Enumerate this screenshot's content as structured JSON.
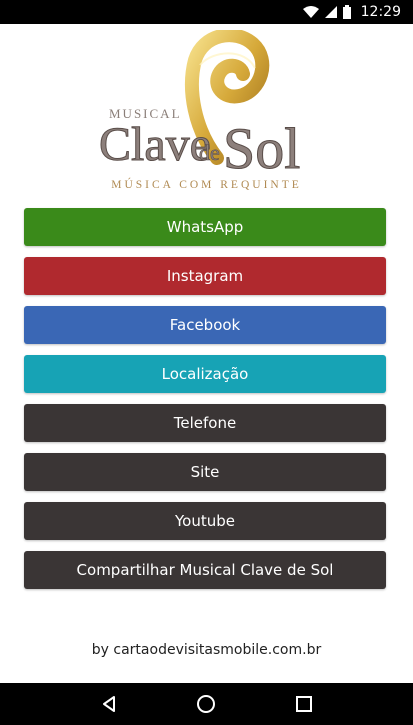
{
  "status_bar": {
    "time": "12:29",
    "icons": [
      "wifi-icon",
      "signal-icon",
      "battery-icon"
    ]
  },
  "logo": {
    "line1": "MUSICAL",
    "line2": "Clave",
    "line3": "de",
    "line4": "Sol",
    "tagline": "MÚSICA COM REQUINTE"
  },
  "buttons": [
    {
      "label": "WhatsApp",
      "color": "#3a8a1a"
    },
    {
      "label": "Instagram",
      "color": "#b0292e"
    },
    {
      "label": "Facebook",
      "color": "#3a67b5"
    },
    {
      "label": "Localização",
      "color": "#17a3b5"
    },
    {
      "label": "Telefone",
      "color": "#3a3535"
    },
    {
      "label": "Site",
      "color": "#3a3535"
    },
    {
      "label": "Youtube",
      "color": "#3a3535"
    },
    {
      "label": "Compartilhar Musical Clave de Sol",
      "color": "#3a3535"
    }
  ],
  "footer": {
    "text": "by cartaodevisitasmobile.com.br"
  },
  "nav_bar": {
    "icons": [
      "back-icon",
      "home-icon",
      "recents-icon"
    ]
  }
}
